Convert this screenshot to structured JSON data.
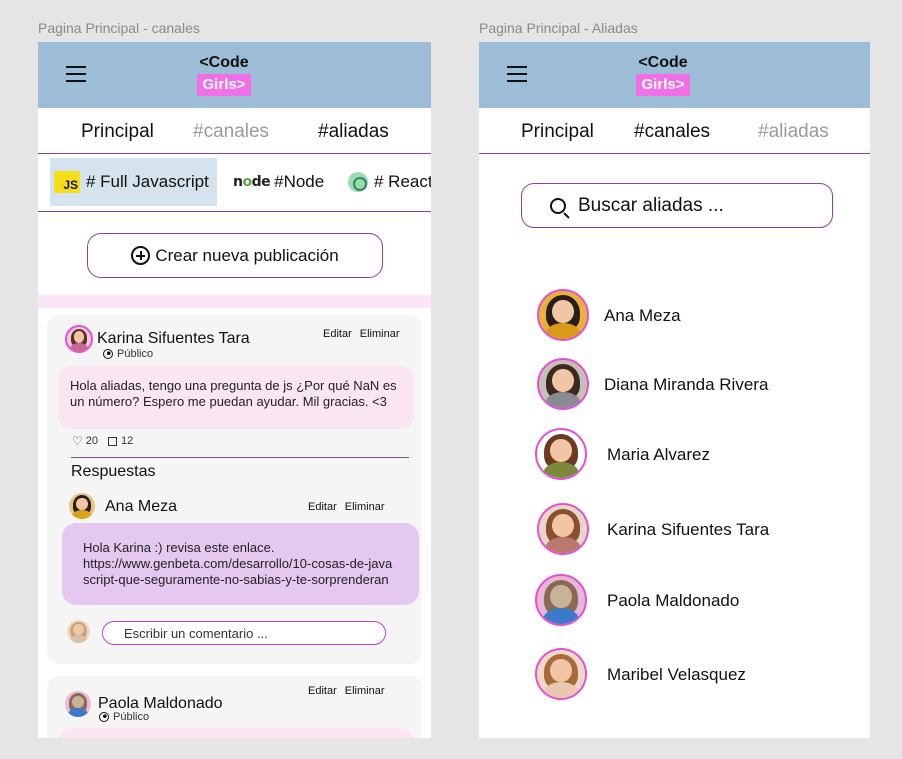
{
  "frames": {
    "left_label": "Pagina Principal - canales",
    "right_label": "Pagina Principal - Aliadas"
  },
  "header": {
    "logo_line1": "<Code",
    "logo_line2": "Girls>"
  },
  "tabs": {
    "principal": "Principal",
    "canales": "#canales",
    "aliadas": "#aliadas"
  },
  "channels": [
    {
      "label": "# Full Javascript",
      "icon": "javascript-logo",
      "logo_text": "JS"
    },
    {
      "label": "#Node",
      "icon": "nodejs-logo",
      "logo_text": "node"
    },
    {
      "label": "# React",
      "icon": "react-logo"
    }
  ],
  "create_post": {
    "label": "Crear nueva publicación"
  },
  "posts": [
    {
      "author": "Karina Sifuentes Tara",
      "visibility": "Público",
      "edit": "Editar",
      "delete": "Eliminar",
      "body": "Hola aliadas, tengo una pregunta de js ¿Por qué NaN es un número? Espero me puedan ayudar. Mil gracias. <3",
      "likes": "20",
      "comments": "12",
      "responses_title": "Respuestas",
      "responses": [
        {
          "author": "Ana Meza",
          "edit": "Editar",
          "delete": "Eliminar",
          "body_line1": "Hola Karina :) revisa este enlace.",
          "body_line2": "https://www.genbeta.com/desarrollo/10-cosas-de-java",
          "body_line3": "script-que-seguramente-no-sabias-y-te-sorprenderan"
        }
      ],
      "comment_placeholder": "Escribir un comentario ..."
    },
    {
      "author": "Paola Maldonado",
      "visibility": "Público",
      "edit": "Editar",
      "delete": "Eliminar"
    }
  ],
  "search": {
    "placeholder": "Buscar aliadas ..."
  },
  "allies": [
    {
      "name": "Ana Meza"
    },
    {
      "name": "Diana Miranda Rivera"
    },
    {
      "name": "Maria Alvarez"
    },
    {
      "name": "Karina Sifuentes Tara"
    },
    {
      "name": "Paola Maldonado"
    },
    {
      "name": "Maribel Velasquez"
    }
  ],
  "colors": {
    "header_bg": "#9dbdd6",
    "logo_pink": "#f06ee6",
    "accent_purple": "#8f3f9e",
    "active_channel_bg": "#d5e3ef",
    "post_pink": "#fae6f0",
    "reply_purple": "#e4c8f0"
  }
}
